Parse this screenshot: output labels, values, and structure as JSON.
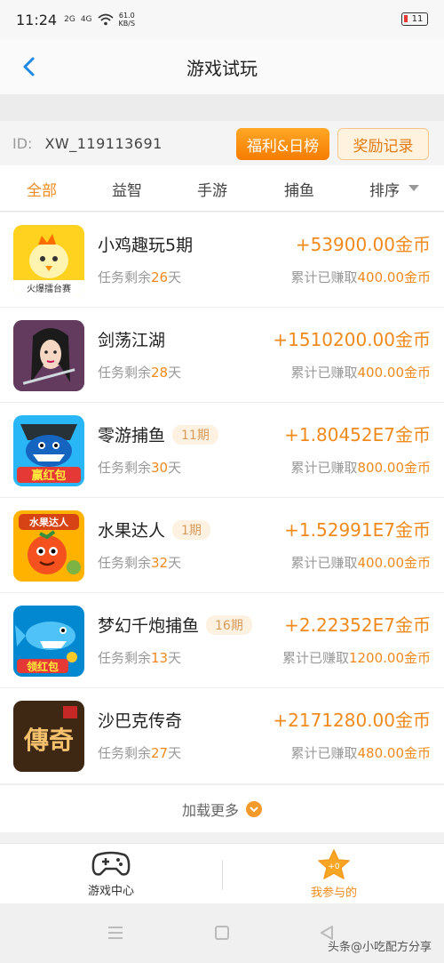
{
  "status_bar": {
    "time": "11:24",
    "signal_1": "2G",
    "signal_2": "4G",
    "speed_value": "61.0",
    "speed_unit": "KB/S",
    "battery": "11"
  },
  "header": {
    "title": "游戏试玩"
  },
  "account": {
    "id_label": "ID:",
    "id_value": "XW_119113691",
    "welfare_button": "福利&日榜",
    "reward_record_button": "奖励记录"
  },
  "tabs": [
    "全部",
    "益智",
    "手游",
    "捕鱼",
    "排序"
  ],
  "games": [
    {
      "name": "小鸡趣玩5期",
      "period": "",
      "remain_prefix": "任务剩余",
      "remain_days": "26",
      "remain_suffix": "天",
      "reward": "+53900.00金币",
      "earned_prefix": "累计已赚取",
      "earned_value": "400.00金币",
      "icon": "chick-game-icon",
      "icon_caption": "火爆擂台赛"
    },
    {
      "name": "剑荡江湖",
      "period": "",
      "remain_prefix": "任务剩余",
      "remain_days": "28",
      "remain_suffix": "天",
      "reward": "+1510200.00金币",
      "earned_prefix": "累计已赚取",
      "earned_value": "400.00金币",
      "icon": "swordswoman-game-icon",
      "icon_caption": ""
    },
    {
      "name": "零游捕鱼",
      "period": "11期",
      "remain_prefix": "任务剩余",
      "remain_days": "30",
      "remain_suffix": "天",
      "reward": "+1.80452E7金币",
      "earned_prefix": "累计已赚取",
      "earned_value": "800.00金币",
      "icon": "shark-game-icon",
      "icon_caption": "赢红包"
    },
    {
      "name": "水果达人",
      "period": "1期",
      "remain_prefix": "任务剩余",
      "remain_days": "32",
      "remain_suffix": "天",
      "reward": "+1.52991E7金币",
      "earned_prefix": "累计已赚取",
      "earned_value": "400.00金币",
      "icon": "fruit-game-icon",
      "icon_caption": "水果达人"
    },
    {
      "name": "梦幻千炮捕鱼",
      "period": "16期",
      "remain_prefix": "任务剩余",
      "remain_days": "13",
      "remain_suffix": "天",
      "reward": "+2.22352E7金币",
      "earned_prefix": "累计已赚取",
      "earned_value": "1200.00金币",
      "icon": "fish-game-icon",
      "icon_caption": "领红包"
    },
    {
      "name": "沙巴克传奇",
      "period": "",
      "remain_prefix": "任务剩余",
      "remain_days": "27",
      "remain_suffix": "天",
      "reward": "+2171280.00金币",
      "earned_prefix": "累计已赚取",
      "earned_value": "480.00金币",
      "icon": "legend-game-icon",
      "icon_caption": "傳奇"
    }
  ],
  "load_more": "加载更多",
  "bottom_tabs": [
    {
      "label": "游戏中心",
      "icon": "gamepad-icon",
      "active": false
    },
    {
      "label": "我参与的",
      "icon": "star-icon",
      "active": true
    }
  ],
  "watermark": "头条@小吃配方分享",
  "colors": {
    "accent": "#f08a1c",
    "blue_back": "#1e88e5"
  }
}
